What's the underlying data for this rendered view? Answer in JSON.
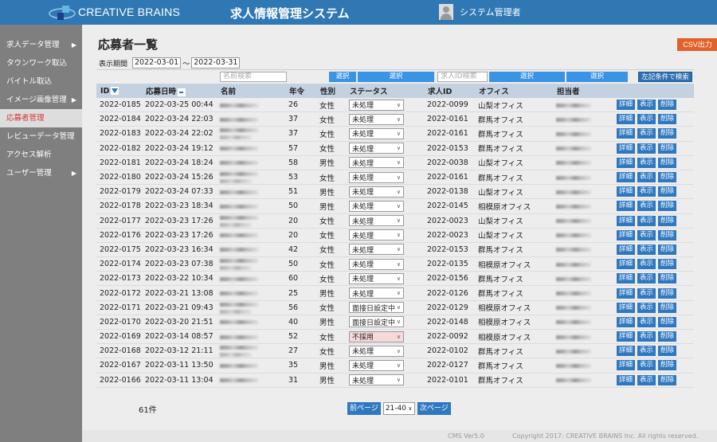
{
  "header": {
    "brand": "CREATIVE BRAINS",
    "app_title": "求人情報管理システム",
    "user_name": "システム管理者",
    "logo_icon": "creative-brains-logo",
    "user_icon": "user-avatar-icon",
    "colors": {
      "bar": "#2f78b4",
      "accent_orange": "#e0612a",
      "active_menu_text": "#d23a3a"
    }
  },
  "sidebar": {
    "items": [
      {
        "label": "求人データ管理",
        "has_submenu": true,
        "active": false
      },
      {
        "label": "タウンワーク取込",
        "has_submenu": false,
        "active": false
      },
      {
        "label": "バイトル取込",
        "has_submenu": false,
        "active": false
      },
      {
        "label": "イメージ画像管理",
        "has_submenu": true,
        "active": false
      },
      {
        "label": "応募者管理",
        "has_submenu": false,
        "active": true
      },
      {
        "label": "レビューデータ管理",
        "has_submenu": false,
        "active": false
      },
      {
        "label": "アクセス解析",
        "has_submenu": false,
        "active": false
      },
      {
        "label": "ユーザー管理",
        "has_submenu": true,
        "active": false
      }
    ],
    "arrow": "▶"
  },
  "page": {
    "title": "応募者一覧",
    "csv_button": "CSV出力",
    "period_label": "表示期間",
    "period_from": "2022-03-01",
    "period_sep": "～",
    "period_to": "2022-03-31"
  },
  "filters": {
    "name_placeholder": "名前検索",
    "select_label": "選択",
    "job_id_placeholder": "求人ID検索",
    "search_button": "左記条件で検索"
  },
  "table": {
    "headers": {
      "id": "ID",
      "applied_at": "応募日時",
      "name": "名前",
      "age": "年令",
      "gender": "性別",
      "status": "ステータス",
      "job_id": "求人ID",
      "office": "オフィス",
      "assignee": "担当者"
    },
    "actions": {
      "detail": "詳細",
      "view": "表示",
      "delete": "削除"
    },
    "rows": [
      {
        "id": "2022-0185",
        "applied_at": "2022-03-25 00:44",
        "age": "26",
        "gender": "女性",
        "status": "未処理",
        "job_id": "2022-0099",
        "office": "山梨オフィス"
      },
      {
        "id": "2022-0184",
        "applied_at": "2022-03-24 22:03",
        "age": "37",
        "gender": "女性",
        "status": "未処理",
        "job_id": "2022-0161",
        "office": "群馬オフィス"
      },
      {
        "id": "2022-0183",
        "applied_at": "2022-03-24 22:02",
        "age": "37",
        "gender": "女性",
        "status": "未処理",
        "job_id": "2022-0161",
        "office": "群馬オフィス"
      },
      {
        "id": "2022-0182",
        "applied_at": "2022-03-24 19:12",
        "age": "57",
        "gender": "女性",
        "status": "未処理",
        "job_id": "2022-0153",
        "office": "群馬オフィス"
      },
      {
        "id": "2022-0181",
        "applied_at": "2022-03-24 18:24",
        "age": "58",
        "gender": "男性",
        "status": "未処理",
        "job_id": "2022-0038",
        "office": "山梨オフィス"
      },
      {
        "id": "2022-0180",
        "applied_at": "2022-03-24 15:26",
        "age": "53",
        "gender": "女性",
        "status": "未処理",
        "job_id": "2022-0161",
        "office": "群馬オフィス"
      },
      {
        "id": "2022-0179",
        "applied_at": "2022-03-24 07:33",
        "age": "51",
        "gender": "男性",
        "status": "未処理",
        "job_id": "2022-0138",
        "office": "山梨オフィス"
      },
      {
        "id": "2022-0178",
        "applied_at": "2022-03-23 18:34",
        "age": "50",
        "gender": "男性",
        "status": "未処理",
        "job_id": "2022-0145",
        "office": "相模原オフィス"
      },
      {
        "id": "2022-0177",
        "applied_at": "2022-03-23 17:26",
        "age": "20",
        "gender": "女性",
        "status": "未処理",
        "job_id": "2022-0023",
        "office": "山梨オフィス"
      },
      {
        "id": "2022-0176",
        "applied_at": "2022-03-23 17:26",
        "age": "20",
        "gender": "女性",
        "status": "未処理",
        "job_id": "2022-0023",
        "office": "山梨オフィス"
      },
      {
        "id": "2022-0175",
        "applied_at": "2022-03-23 16:34",
        "age": "42",
        "gender": "女性",
        "status": "未処理",
        "job_id": "2022-0153",
        "office": "群馬オフィス"
      },
      {
        "id": "2022-0174",
        "applied_at": "2022-03-23 07:38",
        "age": "50",
        "gender": "女性",
        "status": "未処理",
        "job_id": "2022-0135",
        "office": "相模原オフィス"
      },
      {
        "id": "2022-0173",
        "applied_at": "2022-03-22 10:34",
        "age": "60",
        "gender": "女性",
        "status": "未処理",
        "job_id": "2022-0156",
        "office": "群馬オフィス"
      },
      {
        "id": "2022-0172",
        "applied_at": "2022-03-21 13:08",
        "age": "25",
        "gender": "男性",
        "status": "未処理",
        "job_id": "2022-0126",
        "office": "群馬オフィス"
      },
      {
        "id": "2022-0171",
        "applied_at": "2022-03-21 09:43",
        "age": "56",
        "gender": "女性",
        "status": "面接日設定中",
        "job_id": "2022-0129",
        "office": "相模原オフィス"
      },
      {
        "id": "2022-0170",
        "applied_at": "2022-03-20 21:51",
        "age": "40",
        "gender": "男性",
        "status": "面接日設定中",
        "job_id": "2022-0148",
        "office": "相模原オフィス"
      },
      {
        "id": "2022-0169",
        "applied_at": "2022-03-14 08:57",
        "age": "52",
        "gender": "女性",
        "status": "不採用",
        "job_id": "2022-0092",
        "office": "相模原オフィス"
      },
      {
        "id": "2022-0168",
        "applied_at": "2022-03-12 21:11",
        "age": "27",
        "gender": "女性",
        "status": "未処理",
        "job_id": "2022-0102",
        "office": "群馬オフィス"
      },
      {
        "id": "2022-0167",
        "applied_at": "2022-03-11 13:50",
        "age": "35",
        "gender": "男性",
        "status": "未処理",
        "job_id": "2022-0127",
        "office": "群馬オフィス"
      },
      {
        "id": "2022-0166",
        "applied_at": "2022-03-11 13:04",
        "age": "31",
        "gender": "男性",
        "status": "未処理",
        "job_id": "2022-0101",
        "office": "群馬オフィス"
      }
    ]
  },
  "pagination": {
    "total": "61件",
    "prev": "前ページ",
    "current_range": "21-40",
    "next": "次ページ"
  },
  "footer": {
    "version": "CMS Ver5.0",
    "copyright": "Copyright 2017: CREATIVE BRAINS Inc. All rights reserved."
  }
}
